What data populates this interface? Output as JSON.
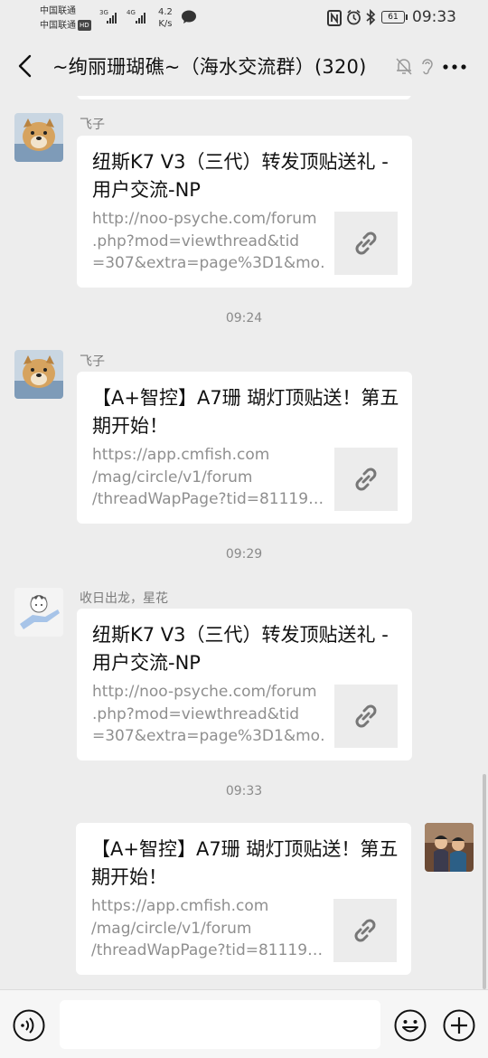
{
  "status_bar": {
    "carrier1": "中国联通",
    "carrier2": "中国联通",
    "hd": "HD",
    "net1": "3G",
    "net2": "4G",
    "speed_value": "4.2",
    "speed_unit": "K/s",
    "battery": "61",
    "time": "09:33"
  },
  "header": {
    "title": "~绚丽珊瑚礁~（海水交流群）(320)"
  },
  "messages": [
    {
      "sender": "飞子",
      "title": "纽斯K7 V3（三代）转发顶贴送礼 - 用户交流-NP",
      "url_lines": [
        "http://noo-psyche.com/forum",
        ".php?mod=viewthread&tid",
        "=307&extra=page%3D1&mo…"
      ]
    },
    {
      "time": "09:24",
      "sender": "飞子",
      "title": "【A+智控】A7珊 瑚灯顶贴送！第五期开始！",
      "url_lines": [
        "https://app.cmfish.com",
        "/mag/circle/v1/forum",
        "/threadWapPage?tid=81119…"
      ]
    },
    {
      "time": "09:29",
      "sender": "收日出龙，星花",
      "title": "纽斯K7 V3（三代）转发顶贴送礼 - 用户交流-NP",
      "url_lines": [
        "http://noo-psyche.com/forum",
        ".php?mod=viewthread&tid",
        "=307&extra=page%3D1&mo…"
      ]
    },
    {
      "time": "09:33",
      "title": "【A+智控】A7珊 瑚灯顶贴送！第五期开始！",
      "url_lines": [
        "https://app.cmfish.com",
        "/mag/circle/v1/forum",
        "/threadWapPage?tid=81119…"
      ]
    }
  ],
  "input": {
    "placeholder": ""
  },
  "icons": {
    "back": "back-arrow-icon",
    "mute": "mute-bell-icon",
    "ear": "earpiece-icon",
    "more": "more-dots-icon",
    "link": "link-icon",
    "voice": "voice-icon",
    "emoji": "emoji-icon",
    "plus": "plus-icon"
  }
}
